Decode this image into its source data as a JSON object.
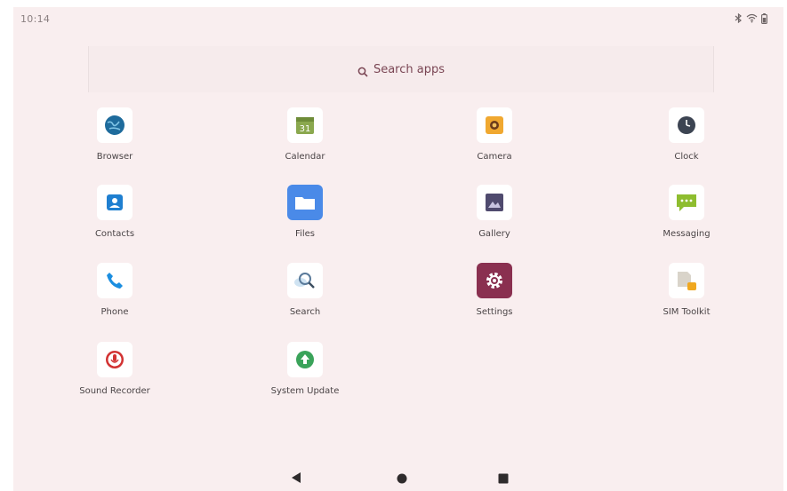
{
  "status_bar": {
    "time": "10:14",
    "icons": [
      "bluetooth-icon",
      "wifi-icon",
      "battery-icon"
    ]
  },
  "search": {
    "label": "Search apps",
    "icon": "search-icon"
  },
  "apps": [
    {
      "label": "Browser",
      "icon": "globe-icon",
      "color": "#1e6b9c"
    },
    {
      "label": "Calendar",
      "icon": "calendar-icon",
      "color": "#8aa84e"
    },
    {
      "label": "Camera",
      "icon": "camera-icon",
      "color": "#f0a830"
    },
    {
      "label": "Clock",
      "icon": "clock-icon",
      "color": "#3c4452"
    },
    {
      "label": "Contacts",
      "icon": "contacts-icon",
      "color": "#1f7fd0"
    },
    {
      "label": "Files",
      "icon": "folder-icon",
      "color": "#4a8ae8"
    },
    {
      "label": "Gallery",
      "icon": "gallery-icon",
      "color": "#4f4a6e"
    },
    {
      "label": "Messaging",
      "icon": "message-icon",
      "color": "#8ebd2f"
    },
    {
      "label": "Phone",
      "icon": "phone-icon",
      "color": "#1b8ee0"
    },
    {
      "label": "Search",
      "icon": "magnifier-icon",
      "color": "#5a7a9a"
    },
    {
      "label": "Settings",
      "icon": "gear-icon",
      "color": "#8a3050"
    },
    {
      "label": "SIM Toolkit",
      "icon": "sim-icon",
      "color": "#f0a820"
    },
    {
      "label": "Sound Recorder",
      "icon": "microphone-icon",
      "color": "#d23232"
    },
    {
      "label": "System Update",
      "icon": "update-icon",
      "color": "#3aa35a"
    }
  ],
  "nav": {
    "back": "back-icon",
    "home": "home-icon",
    "recents": "recents-icon"
  }
}
